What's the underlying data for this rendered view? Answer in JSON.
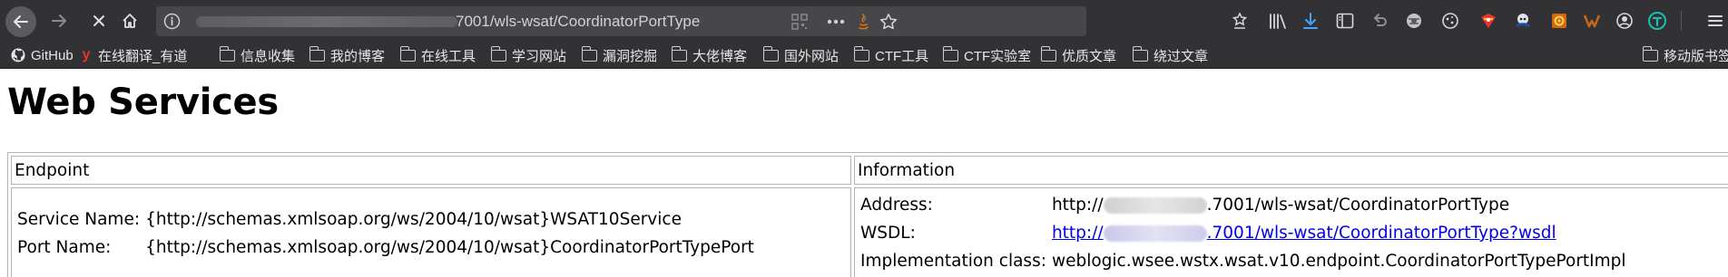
{
  "browser": {
    "url_text": "7001/wls-wsat/CoordinatorPortType",
    "bookmarks": [
      {
        "label": "GitHub",
        "icon": "github-icon"
      },
      {
        "label": "在线翻译_有道",
        "icon": "youdao-icon"
      },
      {
        "label": "信息收集",
        "icon": "folder-icon"
      },
      {
        "label": "我的博客",
        "icon": "folder-icon"
      },
      {
        "label": "在线工具",
        "icon": "folder-icon"
      },
      {
        "label": "学习网站",
        "icon": "folder-icon"
      },
      {
        "label": "漏洞挖掘",
        "icon": "folder-icon"
      },
      {
        "label": "大佬博客",
        "icon": "folder-icon"
      },
      {
        "label": "国外网站",
        "icon": "folder-icon"
      },
      {
        "label": "CTF工具",
        "icon": "folder-icon"
      },
      {
        "label": "CTF实验室",
        "icon": "folder-icon"
      },
      {
        "label": "优质文章",
        "icon": "folder-icon"
      },
      {
        "label": "绕过文章",
        "icon": "folder-icon"
      }
    ],
    "mobile_bookmarks": "移动版书签",
    "colors": {
      "chrome": "#323234",
      "urlbar": "#474749",
      "download_accent": "#45a1ff"
    }
  },
  "page": {
    "title": "Web Services",
    "endpoint_header": "Endpoint",
    "information_header": "Information",
    "endpoint": {
      "service_name_label": "Service Name:",
      "service_name_value": "{http://schemas.xmlsoap.org/ws/2004/10/wsat}WSAT10Service",
      "port_name_label": "Port Name:",
      "port_name_value": "{http://schemas.xmlsoap.org/ws/2004/10/wsat}CoordinatorPortTypePort"
    },
    "information": {
      "address_label": "Address:",
      "address_prefix": "http://",
      "address_suffix": ".7001/wls-wsat/CoordinatorPortType",
      "wsdl_label": "WSDL:",
      "wsdl_prefix": "http://",
      "wsdl_suffix": ".7001/wls-wsat/CoordinatorPortType?wsdl",
      "impl_label": "Implementation class:",
      "impl_value": "weblogic.wsee.wstx.wsat.v10.endpoint.CoordinatorPortTypePortImpl"
    }
  }
}
